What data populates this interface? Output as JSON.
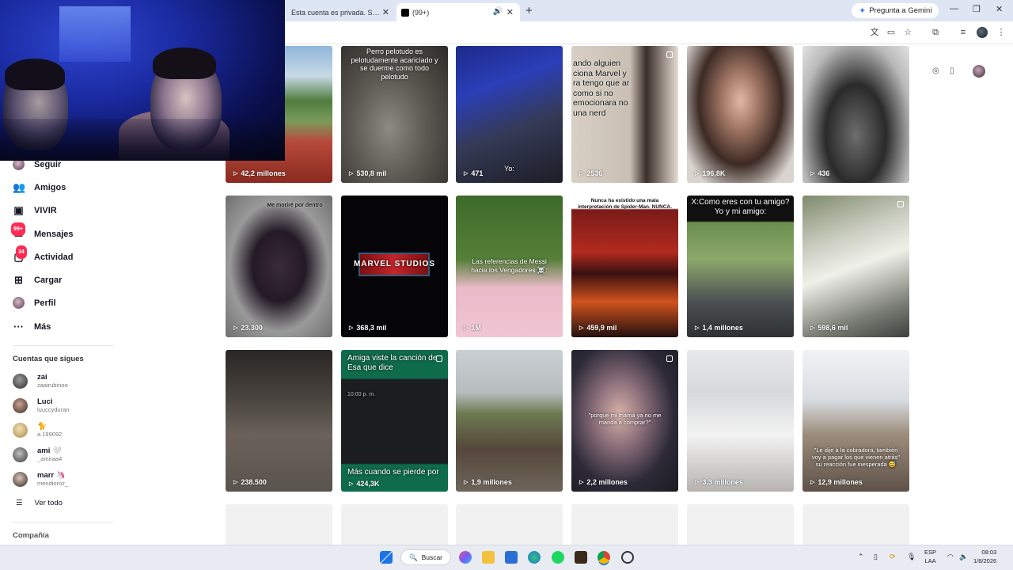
{
  "browser": {
    "tabs": [
      {
        "title": "Esta cuenta es privada. Sigue e...",
        "active": false
      },
      {
        "title": "(99+)",
        "active": true
      }
    ],
    "gemini_label": "Pregunta a Gemini"
  },
  "sidebar": {
    "nav": [
      {
        "label": "Seguir",
        "icon": "avatar-icon"
      },
      {
        "label": "Amigos",
        "icon": "friends-icon"
      },
      {
        "label": "VIVIR",
        "icon": "live-icon"
      },
      {
        "label": "Mensajes",
        "icon": "messages-icon",
        "badge": "99+"
      },
      {
        "label": "Actividad",
        "icon": "activity-icon",
        "badge": "34"
      },
      {
        "label": "Cargar",
        "icon": "upload-icon"
      },
      {
        "label": "Perfil",
        "icon": "profile-icon"
      },
      {
        "label": "Más",
        "icon": "more-icon"
      }
    ],
    "following_title": "Cuentas que sigues",
    "following": [
      {
        "name": "zai",
        "handle": "zaairubinoo"
      },
      {
        "name": "Luci",
        "handle": "luuccyduran"
      },
      {
        "name": "🐈",
        "handle": "a.199092"
      },
      {
        "name": "ami 🤍",
        "handle": "_amiraa4"
      },
      {
        "name": "marr 🦄",
        "handle": "mendioroz_"
      }
    ],
    "see_all": "Ver todo",
    "company": "Compañía"
  },
  "videos": [
    {
      "views": "42,2 millones",
      "overlay": ""
    },
    {
      "views": "530,8 mil",
      "overlay": "Perro pelotudo es pelotudamente acariciado y se duerme como todo pelotudo"
    },
    {
      "views": "471",
      "overlay": "Yo:"
    },
    {
      "views": "2536",
      "overlay": "ando alguien ciona Marvel y ra tengo que ar como si no emocionara no una nerd"
    },
    {
      "views": "196,8K",
      "overlay": ""
    },
    {
      "views": "436",
      "overlay": ""
    },
    {
      "views": "23.300",
      "overlay": "Me moriré por dentro"
    },
    {
      "views": "368,3 mil",
      "overlay": "MARVEL STUDIOS"
    },
    {
      "views": "1M",
      "overlay": "Las referencias de Messi hacia los Vengadores ☠️:"
    },
    {
      "views": "459,9 mil",
      "overlay": "Nunca ha existido una mala interpretación de Spider-Man. NUNCA."
    },
    {
      "views": "1,4 millones",
      "overlay": "X:Como eres con tu amigo? Yo y mi amigo:"
    },
    {
      "views": "598,6 mil",
      "overlay": ""
    },
    {
      "views": "238.500",
      "overlay": ""
    },
    {
      "views": "424,3K",
      "overlay": "Amiga viste la canción de Esa que dice",
      "overlay2": "Más cuando se pierde por",
      "time": "10:00 p. m."
    },
    {
      "views": "1,9 millones",
      "overlay": ""
    },
    {
      "views": "2,2 millones",
      "overlay": "\"porque mi mamá ya no me manda a comprar?\""
    },
    {
      "views": "3,3 millones",
      "overlay": ""
    },
    {
      "views": "12,9 millones",
      "overlay": "\"Le dije a la cobradora, también voy a pagar los que vienen atrás\" su reacción fue inesperada 😅"
    }
  ],
  "taskbar": {
    "search_label": "Buscar",
    "lang_top": "ESP",
    "lang_bottom": "LAA",
    "time": "08:03",
    "date": "1/8/2026"
  }
}
